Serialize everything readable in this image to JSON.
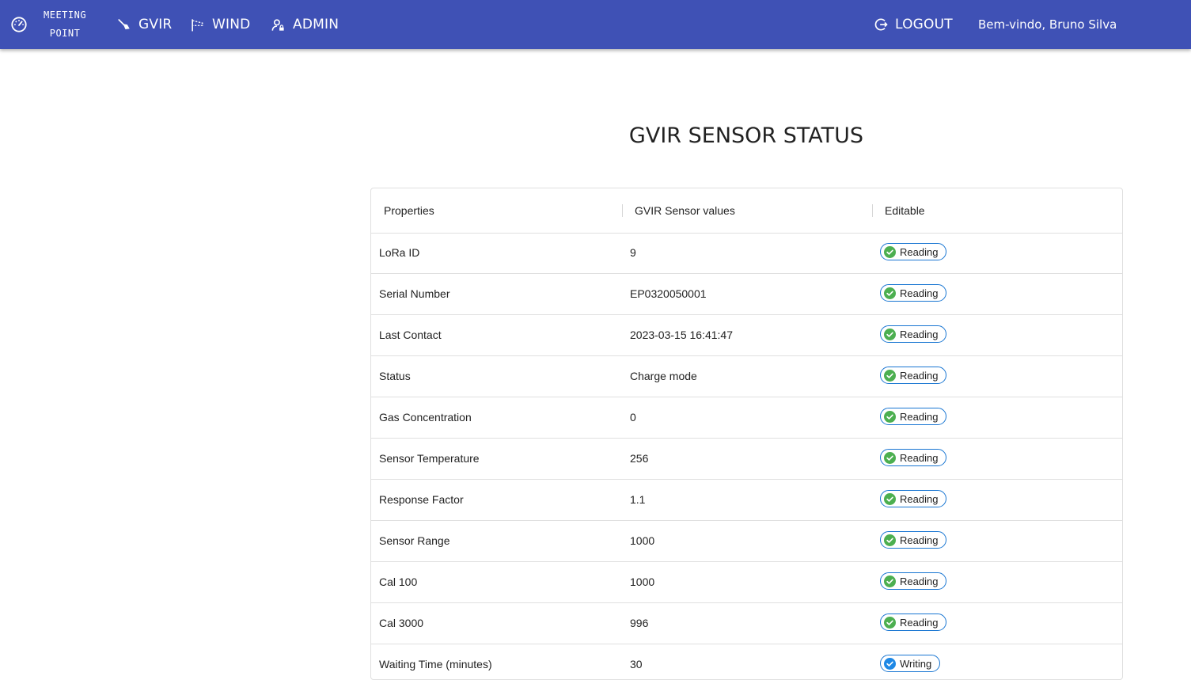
{
  "nav": {
    "logo_line1": "MEETING",
    "logo_line2": "POINT",
    "gvir": "GVIR",
    "wind": "WIND",
    "admin": "ADMIN",
    "logout": "LOGOUT",
    "welcome": "Bem-vindo, Bruno Silva"
  },
  "page": {
    "title": "GVIR SENSOR STATUS"
  },
  "table": {
    "headers": [
      "Properties",
      "GVIR Sensor values",
      "Editable"
    ],
    "rows": [
      {
        "property": "LoRa ID",
        "value": "9",
        "editable": "Reading"
      },
      {
        "property": "Serial Number",
        "value": "EP0320050001",
        "editable": "Reading"
      },
      {
        "property": "Last Contact",
        "value": "2023-03-15 16:41:47",
        "editable": "Reading"
      },
      {
        "property": "Status",
        "value": "Charge mode",
        "editable": "Reading"
      },
      {
        "property": "Gas Concentration",
        "value": "0",
        "editable": "Reading"
      },
      {
        "property": "Sensor Temperature",
        "value": "256",
        "editable": "Reading"
      },
      {
        "property": "Response Factor",
        "value": "1.1",
        "editable": "Reading"
      },
      {
        "property": "Sensor Range",
        "value": "1000",
        "editable": "Reading"
      },
      {
        "property": "Cal 100",
        "value": "1000",
        "editable": "Reading"
      },
      {
        "property": "Cal 3000",
        "value": "996",
        "editable": "Reading"
      },
      {
        "property": "Waiting Time (minutes)",
        "value": "30",
        "editable": "Writing"
      }
    ]
  },
  "colors": {
    "appbar": "#3f51b5",
    "chip_border": "#1976d2",
    "reading_icon": "#4caf50",
    "writing_icon": "#1e88e5"
  }
}
